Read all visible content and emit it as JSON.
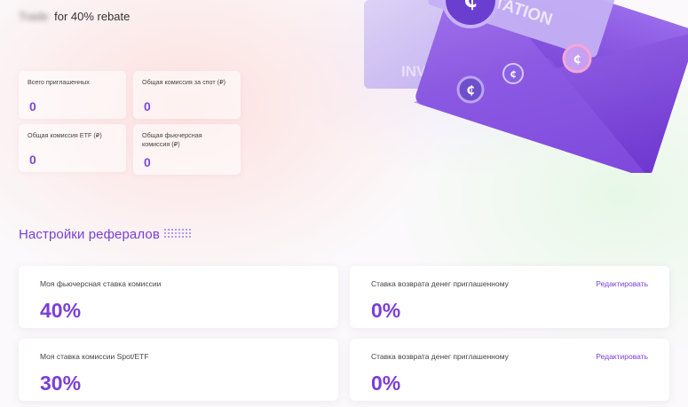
{
  "promo": {
    "blurred": "Trade",
    "text": "for 40% rebate"
  },
  "stats": [
    {
      "label": "Всего приглашенных",
      "value": "0"
    },
    {
      "label": "Общая комиссия за спот (₽)",
      "value": "0"
    },
    {
      "label": "Общая комиссия ETF (₽)",
      "value": "0"
    },
    {
      "label": "Общая фьючерсная комиссия (₽)",
      "value": "0"
    }
  ],
  "art": {
    "text_1": "INVITATION",
    "text_2": "INVITA"
  },
  "referral_settings": {
    "title": "Настройки рефералов",
    "cards": [
      {
        "label": "Моя фьючерсная ставка комиссии",
        "value": "40%"
      },
      {
        "label": "Ставка возврата денег приглашенному",
        "value": "0%",
        "action": "Редактировать"
      },
      {
        "label": "Моя ставка комиссии Spot/ETF",
        "value": "30%"
      },
      {
        "label": "Ставка возврата денег приглашенному",
        "value": "0%",
        "action": "Редактировать"
      }
    ]
  },
  "colors": {
    "accent": "#7b3ed6",
    "envelope": "#8a55e0"
  }
}
